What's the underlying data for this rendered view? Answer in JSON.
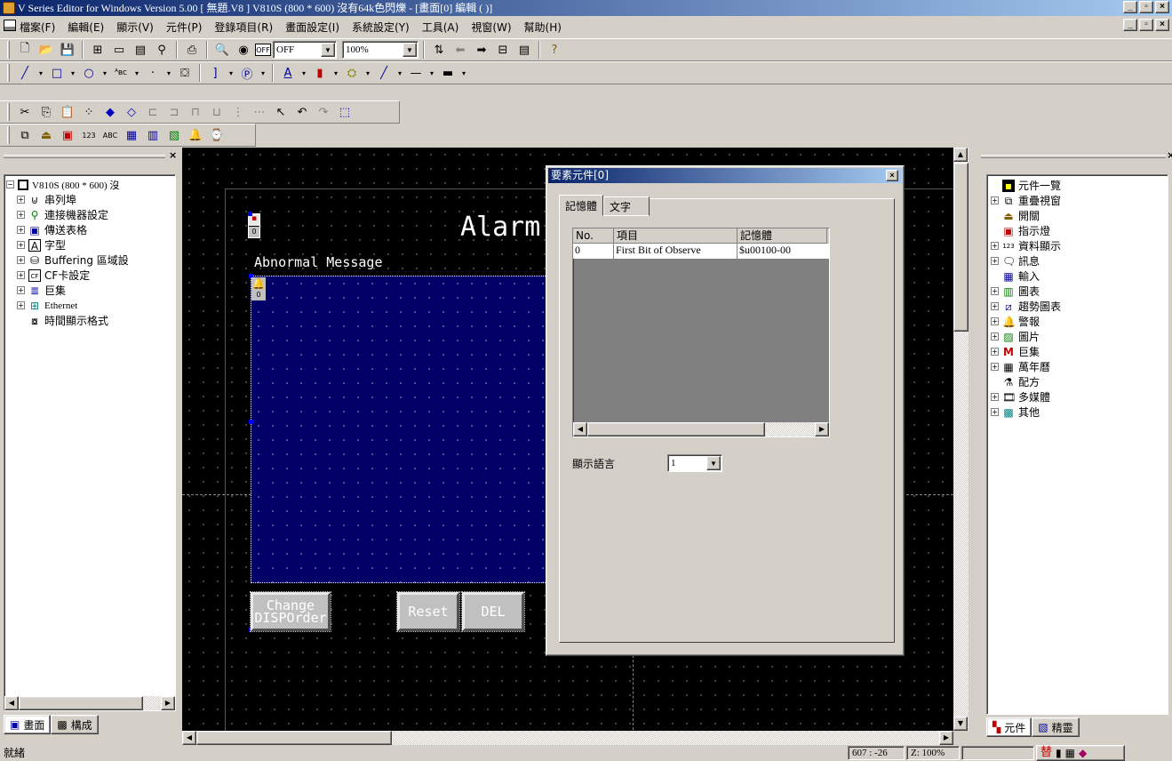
{
  "window": {
    "title": "V Series Editor for Windows Version 5.00 [ 無題.V8 ] V810S (800 * 600) 沒有64k色閃爍 - [畫面[0] 編輯 (          )]",
    "min": "_",
    "max": "\u0001",
    "close": "×"
  },
  "menu": {
    "items": [
      "檔案(F)",
      "編輯(E)",
      "顯示(V)",
      "元件(P)",
      "登錄項目(R)",
      "畫面設定(I)",
      "系統設定(Y)",
      "工具(A)",
      "視窗(W)",
      "幫助(H)"
    ]
  },
  "toolbar1": {
    "off_button": "OFF",
    "off_combo": "OFF",
    "zoom_combo": "100%"
  },
  "left_panel": {
    "close": "×",
    "tree_root": "V810S (800 * 600) 沒",
    "items": [
      "串列埠",
      "連接機器設定",
      "傳送表格",
      "字型",
      "Buffering 區域設",
      "CF卡設定",
      "巨集",
      "Ethernet",
      "時間顯示格式"
    ],
    "tabs": [
      "畫面",
      "構成"
    ]
  },
  "canvas": {
    "marker_1": "0",
    "marker_2": "0",
    "title_text": "Alarm",
    "label": "Abnormal Message",
    "btn_change_1": "Change",
    "btn_change_2": "DISPOrder",
    "btn_reset": "Reset",
    "btn_del": "DEL"
  },
  "dialog": {
    "title": "要素元件[0]",
    "close": "×",
    "tabs": [
      "記憶體",
      "文字"
    ],
    "columns": [
      "No.",
      "項目",
      "記憶體"
    ],
    "rows": [
      {
        "no": "0",
        "item": "First Bit of Observe",
        "mem": "$u00100-00"
      }
    ],
    "lang_label": "顯示語言",
    "lang_value": "1"
  },
  "right_panel": {
    "close": "×",
    "items": [
      "元件一覽",
      "重疊視窗",
      "開關",
      "指示燈",
      "資料顯示",
      "訊息",
      "輸入",
      "圖表",
      "趨勢圖表",
      "警報",
      "圖片",
      "巨集",
      "萬年曆",
      "配方",
      "多媒體",
      "其他"
    ],
    "tabs": [
      "元件",
      "精靈"
    ]
  },
  "status": {
    "ready": "就緒",
    "coords": "607 : -26",
    "zoom": "Z: 100%"
  },
  "ime": {
    "char": "替"
  }
}
